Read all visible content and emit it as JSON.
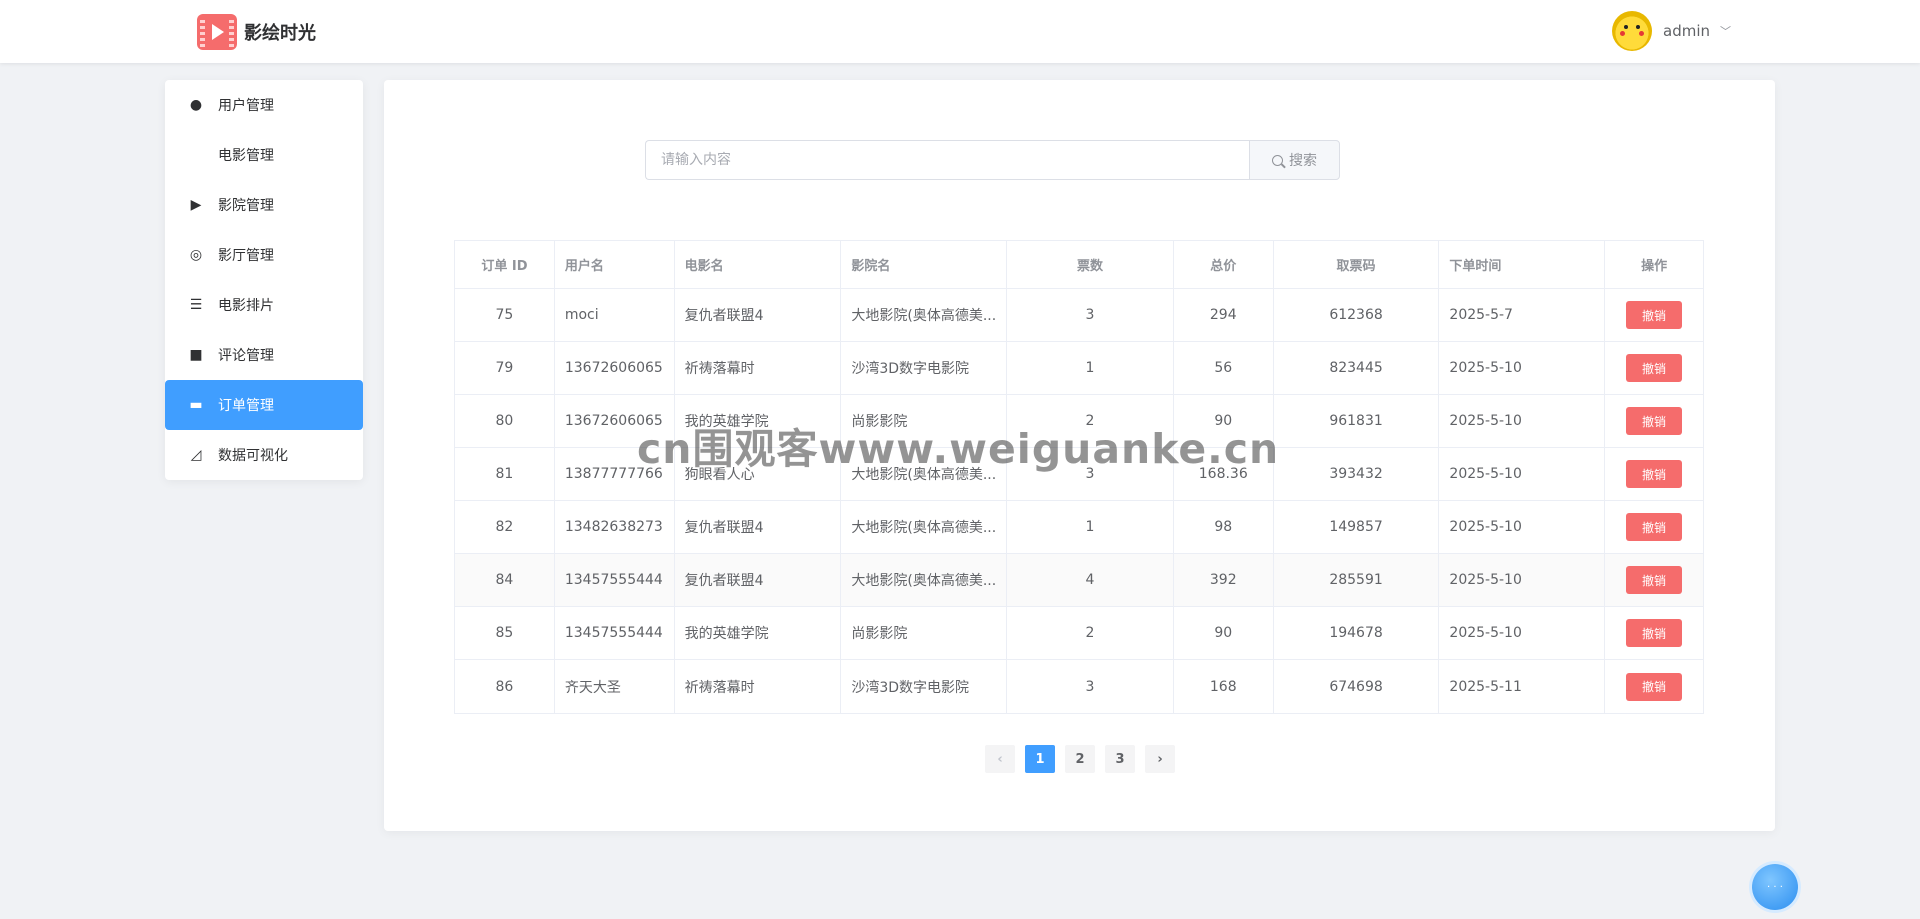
{
  "app": {
    "name": "影绘时光"
  },
  "user": {
    "name": "admin"
  },
  "sidebar": {
    "items": [
      {
        "label": "用户管理",
        "icon": "user-icon"
      },
      {
        "label": "电影管理",
        "icon": ""
      },
      {
        "label": "影院管理",
        "icon": "camera-icon"
      },
      {
        "label": "影厅管理",
        "icon": "lifebuoy-icon"
      },
      {
        "label": "电影排片",
        "icon": "list-icon"
      },
      {
        "label": "评论管理",
        "icon": "comment-icon"
      },
      {
        "label": "订单管理",
        "icon": "ticket-icon",
        "active": true
      },
      {
        "label": "数据可视化",
        "icon": "chart-icon"
      }
    ]
  },
  "search": {
    "placeholder": "请输入内容",
    "button_label": "搜索"
  },
  "table": {
    "headers": [
      "订单 ID",
      "用户名",
      "电影名",
      "影院名",
      "票数",
      "总价",
      "取票码",
      "下单时间",
      "操作"
    ],
    "action_label": "撤销",
    "rows": [
      {
        "id": "75",
        "user": "moci",
        "movie": "复仇者联盟4",
        "cinema": "大地影院(奥体高德美...",
        "tickets": "3",
        "total": "294",
        "code": "612368",
        "time": "2025-5-7"
      },
      {
        "id": "79",
        "user": "13672606065",
        "movie": "祈祷落幕时",
        "cinema": "沙湾3D数字电影院",
        "tickets": "1",
        "total": "56",
        "code": "823445",
        "time": "2025-5-10"
      },
      {
        "id": "80",
        "user": "13672606065",
        "movie": "我的英雄学院",
        "cinema": "尚影影院",
        "tickets": "2",
        "total": "90",
        "code": "961831",
        "time": "2025-5-10"
      },
      {
        "id": "81",
        "user": "13877777766",
        "movie": "狗眼看人心",
        "cinema": "大地影院(奥体高德美...",
        "tickets": "3",
        "total": "168.36",
        "code": "393432",
        "time": "2025-5-10"
      },
      {
        "id": "82",
        "user": "13482638273",
        "movie": "复仇者联盟4",
        "cinema": "大地影院(奥体高德美...",
        "tickets": "1",
        "total": "98",
        "code": "149857",
        "time": "2025-5-10"
      },
      {
        "id": "84",
        "user": "13457555444",
        "movie": "复仇者联盟4",
        "cinema": "大地影院(奥体高德美...",
        "tickets": "4",
        "total": "392",
        "code": "285591",
        "time": "2025-5-10"
      },
      {
        "id": "85",
        "user": "13457555444",
        "movie": "我的英雄学院",
        "cinema": "尚影影院",
        "tickets": "2",
        "total": "90",
        "code": "194678",
        "time": "2025-5-10"
      },
      {
        "id": "86",
        "user": "齐天大圣",
        "movie": "祈祷落幕时",
        "cinema": "沙湾3D数字电影院",
        "tickets": "3",
        "total": "168",
        "code": "674698",
        "time": "2025-5-11"
      }
    ]
  },
  "pagination": {
    "pages": [
      "1",
      "2",
      "3"
    ],
    "current": "1",
    "prev": "‹",
    "next": "›"
  },
  "watermark": {
    "text": "cn围观客www.weiguanke.cn"
  },
  "colors": {
    "primary": "#409eff",
    "danger": "#f56c6c",
    "background": "#f0f2f5"
  }
}
